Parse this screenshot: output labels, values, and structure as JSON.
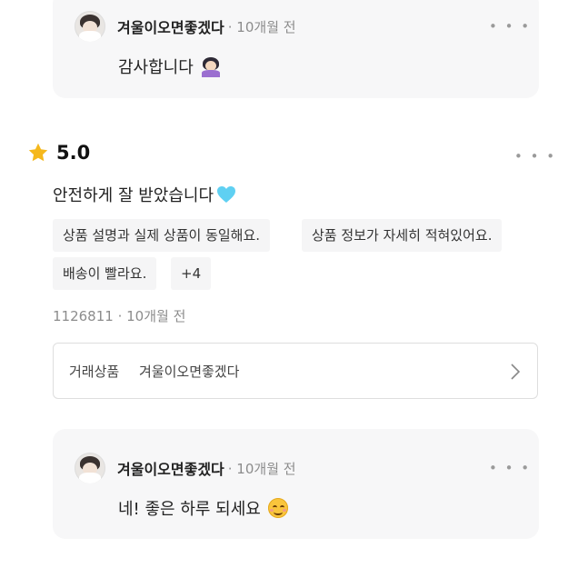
{
  "replies": [
    {
      "name": "겨울이오면좋겠다",
      "time": "· 10개월 전",
      "text": "감사합니다",
      "emoji": "person-bowing-emoji"
    },
    {
      "name": "겨울이오면좋겠다",
      "time": "· 10개월 전",
      "text": "네! 좋은 하루 되세요",
      "emoji": "smiling-face-emoji"
    }
  ],
  "more_menu_glyph": "• • •",
  "review": {
    "rating": "5.0",
    "text": "안전하게 잘 받았습니다",
    "text_emoji": "light-blue-heart-emoji",
    "tags": [
      "상품 설명과 실제 상품이 동일해요.",
      "상품 정보가 자세히 적혀있어요.",
      "배송이 빨라요.",
      "+4"
    ],
    "meta": "1126811 · 10개월 전",
    "product_label": "거래상품",
    "product_name": "겨울이오면좋겠다"
  },
  "colors": {
    "star": "#f5b81c",
    "heart": "#5fd0f2",
    "card_bg": "#f7f7f8",
    "muted_text": "#8c8c8c"
  }
}
